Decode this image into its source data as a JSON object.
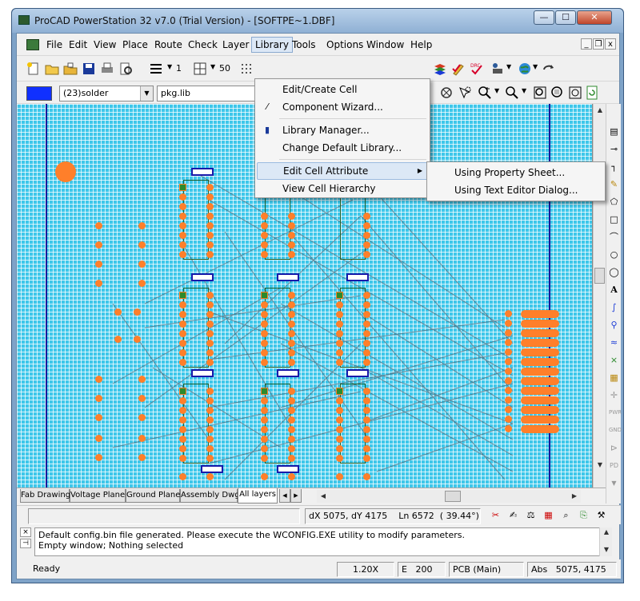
{
  "window": {
    "title": "ProCAD PowerStation 32 v7.0 (Trial Version) - [SOFTPE~1.DBF]",
    "controls": {
      "minimize": "—",
      "maximize": "☐",
      "close": "✕"
    }
  },
  "menubar": {
    "items": [
      "File",
      "Edit",
      "View",
      "Place",
      "Route",
      "Check",
      "Layer",
      "Library",
      "Tools",
      "Options",
      "Window",
      "Help"
    ],
    "active": "Library",
    "mdi_controls": {
      "minimize": "_",
      "restore": "❐",
      "close": "x"
    }
  },
  "toolbar": {
    "line_width": "1",
    "grid_value": "50"
  },
  "toolbar2": {
    "accent_color": "#1030ff",
    "layer_select": "(23)solder",
    "library_select": "pkg.lib"
  },
  "library_menu": {
    "items": [
      {
        "label": "Edit/Create Cell",
        "icon": ""
      },
      {
        "label": "Component Wizard...",
        "icon": "wand-icon"
      },
      {
        "label": "Library Manager...",
        "icon": "book-icon"
      },
      {
        "label": "Change Default Library...",
        "icon": ""
      },
      {
        "label": "Edit Cell Attribute",
        "icon": "",
        "has_submenu": true
      },
      {
        "label": "View Cell Hierarchy",
        "icon": ""
      }
    ]
  },
  "submenu": {
    "items": [
      "Using Property Sheet...",
      "Using Text Editor Dialog..."
    ]
  },
  "tabs": [
    "Fab Drawing",
    "Voltage Plane",
    "Ground Plane",
    "Assembly Dwg",
    "All layers"
  ],
  "active_tab": "All layers",
  "coord_status": {
    "dxdy": "dX 5075, dY 4175",
    "ln": "Ln 6572",
    "angle": "( 39.44°)"
  },
  "console": {
    "lines": [
      "Default config.bin file generated. Please execute the WCONFIG.EXE utility to modify parameters.",
      "Empty window; Nothing selected"
    ]
  },
  "statusbar": {
    "ready": "Ready",
    "zoom": "1.20X",
    "e_label": "E",
    "e_value": "200",
    "mode": "PCB (Main)",
    "abs_label": "Abs",
    "abs_value": "5075, 4175"
  },
  "colors": {
    "canvas": "#3ec7ea",
    "pads": "#ff7f2a",
    "board_outline": "#1a1a9a"
  }
}
